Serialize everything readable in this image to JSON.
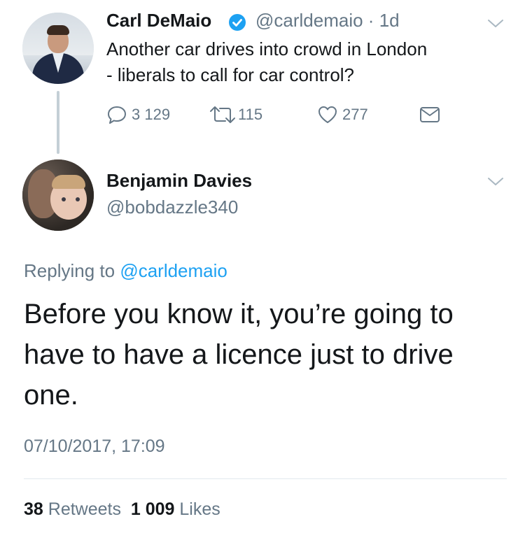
{
  "parent_tweet": {
    "author_name": "Carl DeMaio",
    "handle": "@carldemaio",
    "separator": "·",
    "time_ago": "1d",
    "text_lines": [
      "Another car drives into crowd in London",
      "- liberals to call for car control?"
    ],
    "replies": "3 129",
    "retweets": "115",
    "likes": "277"
  },
  "reply_tweet": {
    "author_name": "Benjamin Davies",
    "handle": "@bobdazzle340",
    "replying_label": "Replying to",
    "replying_to": "@carldemaio",
    "text_lines": [
      "Before you know it, you’re going to",
      "have to have a licence just to drive",
      "one."
    ],
    "timestamp": "07/10/2017, 17:09",
    "retweet_count": "38",
    "retweet_label": "Retweets",
    "like_count": "1 009",
    "like_label": "Likes"
  },
  "colors": {
    "accent": "#1da1f2",
    "secondary_text": "#657786",
    "primary_text": "#14171a",
    "divider": "#e1e8ed"
  },
  "icons": [
    "verified-badge-icon",
    "chevron-down-icon",
    "reply-icon",
    "retweet-icon",
    "heart-icon",
    "envelope-icon"
  ]
}
